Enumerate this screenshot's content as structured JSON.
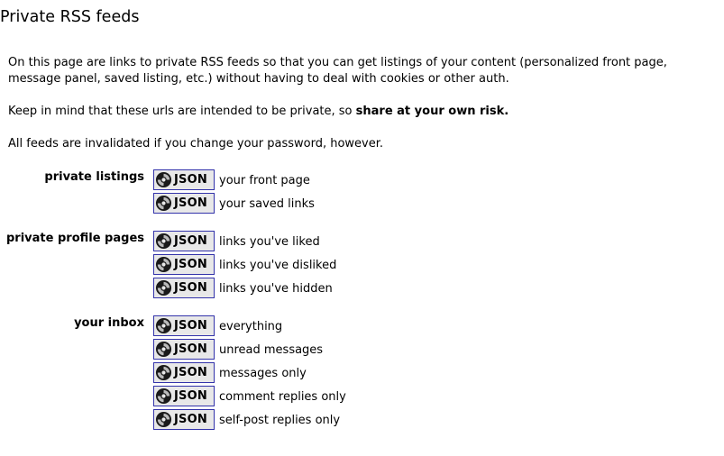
{
  "page": {
    "title": "Private RSS feeds",
    "intro": "On this page are links to private RSS feeds so that you can get listings of your content (personalized front page, message panel, saved listing, etc.) without having to deal with cookies or other auth.",
    "warning_prefix": "Keep in mind that these urls are intended to be private, so ",
    "warning_strong": "share at your own risk.",
    "note": "All feeds are invalidated if you change your password, however."
  },
  "sections": [
    {
      "label": "private listings",
      "feeds": [
        {
          "button": "JSON",
          "description": "your front page"
        },
        {
          "button": "JSON",
          "description": "your saved links"
        }
      ]
    },
    {
      "label": "private profile pages",
      "feeds": [
        {
          "button": "JSON",
          "description": "links you've liked"
        },
        {
          "button": "JSON",
          "description": "links you've disliked"
        },
        {
          "button": "JSON",
          "description": "links you've hidden"
        }
      ]
    },
    {
      "label": "your inbox",
      "feeds": [
        {
          "button": "JSON",
          "description": "everything"
        },
        {
          "button": "JSON",
          "description": "unread messages"
        },
        {
          "button": "JSON",
          "description": "messages only"
        },
        {
          "button": "JSON",
          "description": "comment replies only"
        },
        {
          "button": "JSON",
          "description": "self-post replies only"
        }
      ]
    }
  ],
  "icons": {
    "json_button_icon": "json-logo-icon"
  }
}
